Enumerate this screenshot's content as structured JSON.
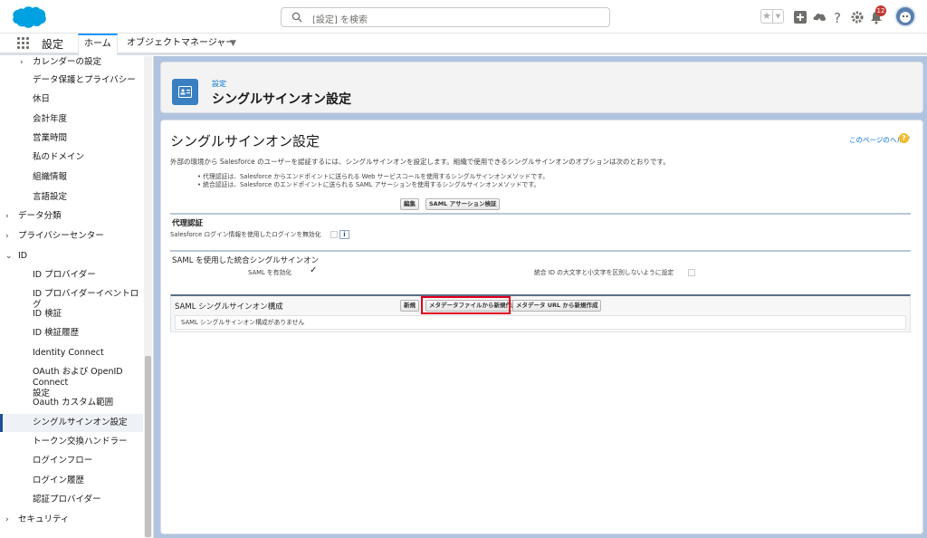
{
  "global_header": {
    "search_placeholder": "[設定] を検索",
    "notification_count": "12"
  },
  "nav": {
    "app_name": "設定",
    "tabs": [
      {
        "label": "ホーム"
      },
      {
        "label": "オブジェクトマネージャー"
      }
    ]
  },
  "sidebar": {
    "items": [
      {
        "label": "カレンダーの設定"
      },
      {
        "label": "データ保護とプライバシー"
      },
      {
        "label": "休日"
      },
      {
        "label": "会計年度"
      },
      {
        "label": "営業時間"
      },
      {
        "label": "私のドメイン"
      },
      {
        "label": "組織情報"
      },
      {
        "label": "言語設定"
      },
      {
        "label": "データ分類"
      },
      {
        "label": "プライバシーセンター"
      },
      {
        "label": "ID"
      },
      {
        "label": "ID プロバイダー"
      },
      {
        "label": "ID プロバイダーイベントログ"
      },
      {
        "label": "ID 検証"
      },
      {
        "label": "ID 検証履歴"
      },
      {
        "label": "Identity Connect"
      },
      {
        "label": "OAuth および OpenID Connect"
      },
      {
        "label": "設定"
      },
      {
        "label": "Oauth カスタム範囲"
      },
      {
        "label": "シングルサインオン設定"
      },
      {
        "label": "トークン交換ハンドラー"
      },
      {
        "label": "ログインフロー"
      },
      {
        "label": "ログイン履歴"
      },
      {
        "label": "認証プロバイダー"
      },
      {
        "label": "セキュリティ"
      }
    ]
  },
  "page_header": {
    "breadcrumb": "設定",
    "title": "シングルサインオン設定"
  },
  "content": {
    "title": "シングルサインオン設定",
    "help_link": "このページのヘルプ",
    "description": "外部の環境から Salesforce のユーザーを認証するには、シングルサインオンを設定します。組織で使用できるシングルサインオンのオプションは次のとおりです。",
    "bullets": [
      "• 代理認証は、Salesforce からエンドポイントに送られる Web サービスコールを使用するシングルサインオンメソッドです。",
      "• 統合認証は、Salesforce のエンドポイントに送られる SAML アサーションを使用するシングルサインオンメソッドです。"
    ],
    "buttons": {
      "edit": "編集",
      "saml_validate": "SAML アサーション検証"
    },
    "delegated": {
      "heading": "代理認証",
      "label": "Salesforce ログイン情報を使用したログインを無効化"
    },
    "saml": {
      "heading": "SAML を使用した統合シングルサインオン",
      "enabled_label": "SAML を有効化",
      "enabled_value": "✓",
      "case_label": "統合 ID の大文字と小文字を区別しないように設定"
    },
    "configs": {
      "heading": "SAML シングルサインオン構成",
      "new": "新規",
      "new_from_metadata_file": "メタデータファイルから新規作成",
      "new_from_metadata_url": "メタデータ URL から新規作成",
      "empty": "SAML シングルサインオン構成がありません"
    }
  },
  "colors": {
    "brand": "#00a1e0",
    "accent": "#1b96ff",
    "highlight": "#e0001b"
  }
}
